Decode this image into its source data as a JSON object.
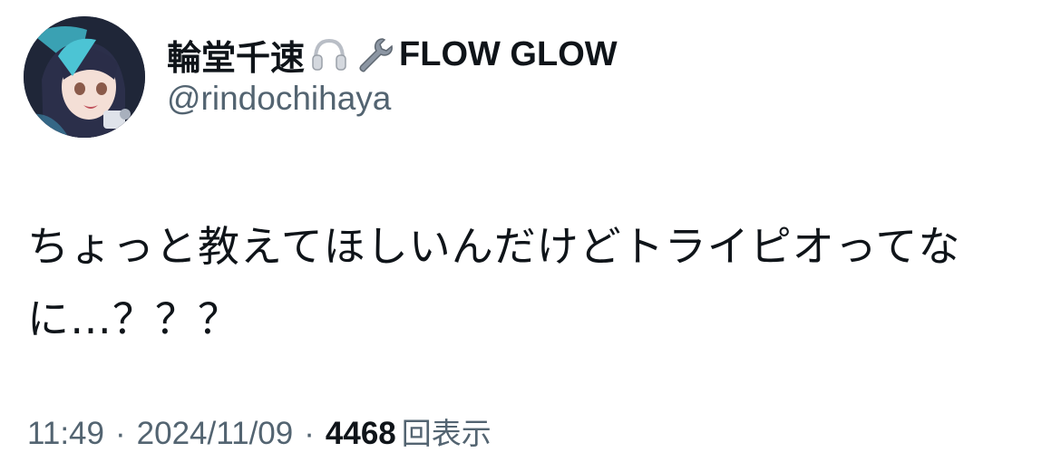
{
  "author": {
    "display_name": "輪堂千速",
    "name_emojis": [
      "headphones-emoji",
      "wrench-emoji"
    ],
    "name_suffix": "FLOW GLOW",
    "handle": "@rindochihaya",
    "avatar": "avatar-image"
  },
  "tweet": {
    "text": "ちょっと教えてほしいんだけどトライピオってなに…？？？",
    "time": "11:49",
    "date": "2024/11/09",
    "separator": "·",
    "views_count": "4468",
    "views_label": "回表示"
  },
  "colors": {
    "primary_text": "#0f1419",
    "secondary_text": "#536471",
    "background": "#ffffff"
  }
}
